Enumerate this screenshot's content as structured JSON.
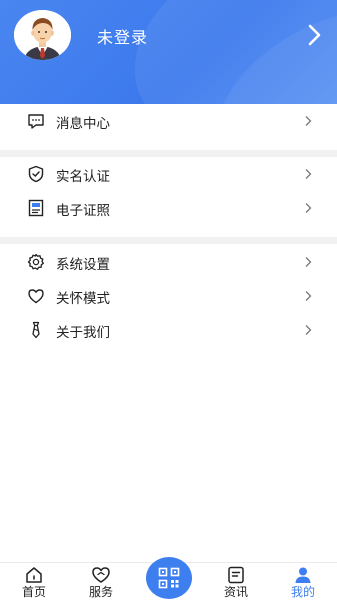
{
  "header": {
    "login_label": "未登录"
  },
  "menu": {
    "group1": [
      {
        "label": "消息中心",
        "icon": "message-icon"
      }
    ],
    "group2": [
      {
        "label": "实名认证",
        "icon": "shield-icon"
      },
      {
        "label": "电子证照",
        "icon": "id-card-icon"
      }
    ],
    "group3": [
      {
        "label": "系统设置",
        "icon": "gear-icon"
      },
      {
        "label": "关怀模式",
        "icon": "heart-icon"
      },
      {
        "label": "关于我们",
        "icon": "tie-icon"
      }
    ]
  },
  "tabbar": {
    "tabs": [
      {
        "label": "首页",
        "icon": "home-icon"
      },
      {
        "label": "服务",
        "icon": "service-heart-icon"
      },
      {
        "label": "资讯",
        "icon": "news-icon"
      },
      {
        "label": "我的",
        "icon": "user-icon"
      }
    ],
    "active": "我的",
    "scan_icon": "qr-scan-icon"
  },
  "colors": {
    "accent": "#3d7ff0",
    "header": "#4a86f0",
    "separator": "#f1f1f1"
  }
}
